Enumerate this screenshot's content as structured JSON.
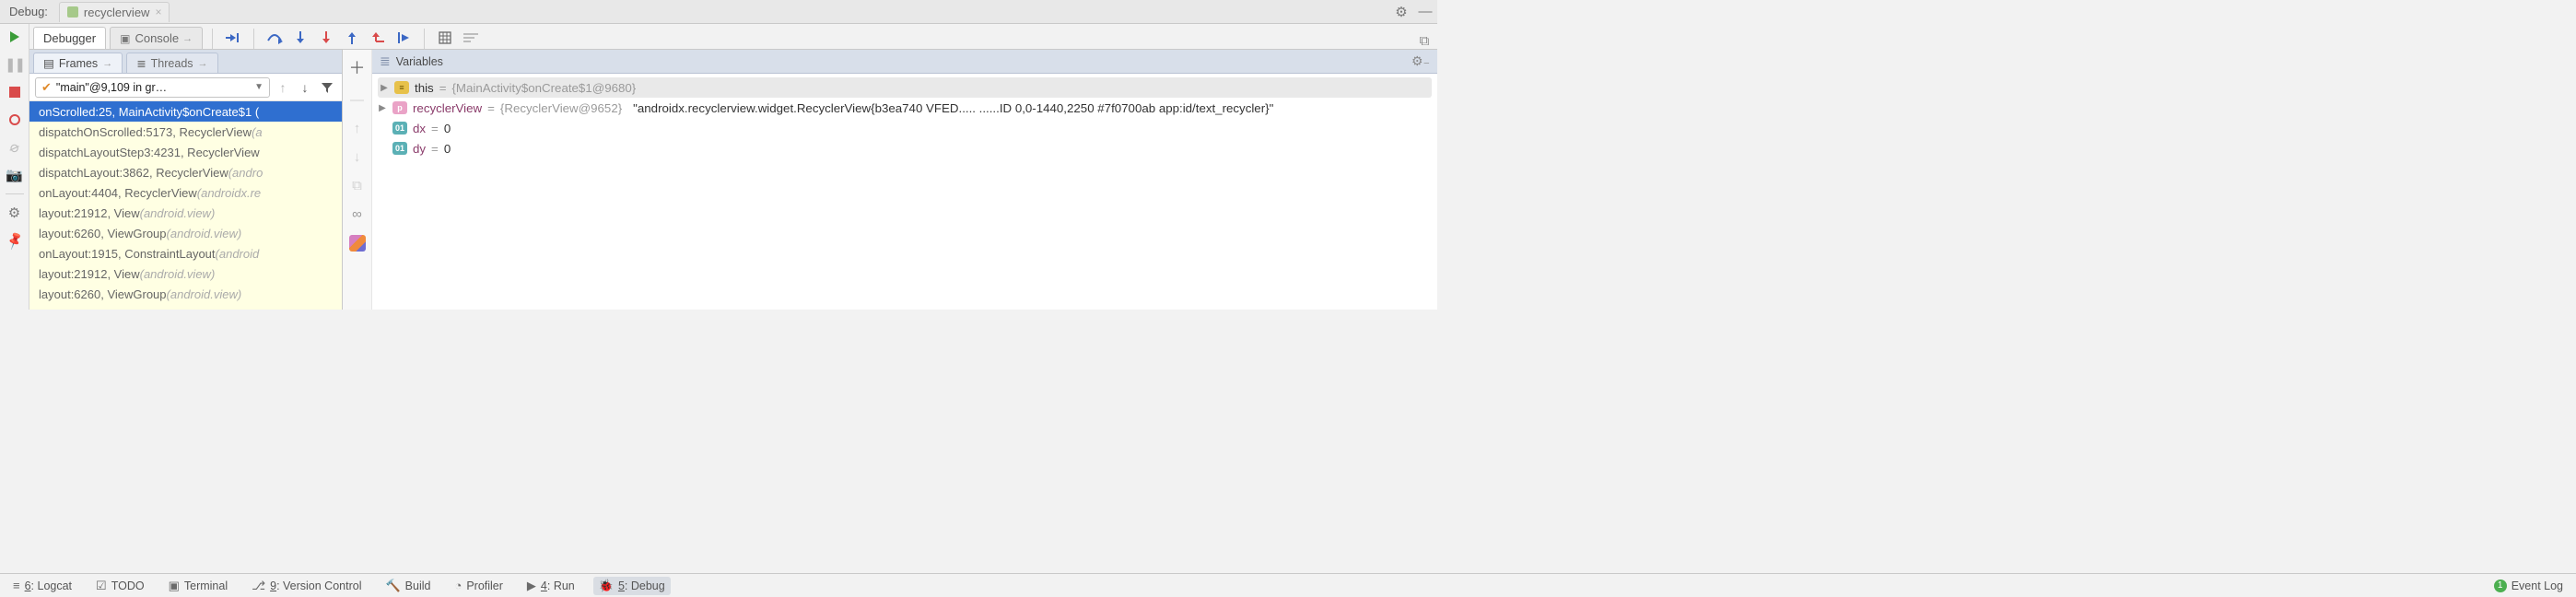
{
  "toolwindow": {
    "title": "Debug:"
  },
  "runconfig": {
    "name": "recyclerview"
  },
  "tabs": {
    "debugger": "Debugger",
    "console": "Console"
  },
  "panels": {
    "frames": "Frames",
    "threads": "Threads",
    "variables": "Variables"
  },
  "thread_selector": {
    "value": "\"main\"@9,109 in gr…"
  },
  "frames": [
    {
      "text": "onScrolled:25, MainActivity$onCreate$1 (",
      "selected": true
    },
    {
      "text": "dispatchOnScrolled:5173, RecyclerView ",
      "dim": "(a"
    },
    {
      "text": "dispatchLayoutStep3:4231, RecyclerView"
    },
    {
      "text": "dispatchLayout:3862, RecyclerView ",
      "dim": "(andro"
    },
    {
      "text": "onLayout:4404, RecyclerView ",
      "dim": "(androidx.re"
    },
    {
      "text": "layout:21912, View ",
      "dim": "(android.view)"
    },
    {
      "text": "layout:6260, ViewGroup ",
      "dim": "(android.view)"
    },
    {
      "text": "onLayout:1915, ConstraintLayout ",
      "dim": "(android"
    },
    {
      "text": "layout:21912, View ",
      "dim": "(android.view)"
    },
    {
      "text": "layout:6260, ViewGroup ",
      "dim": "(android.view)"
    }
  ],
  "variables": {
    "this_label": "this",
    "this_value": "{MainActivity$onCreate$1@9680}",
    "rv_name": "recyclerView",
    "rv_obj": "{RecyclerView@9652}",
    "rv_str": "\"androidx.recyclerview.widget.RecyclerView{b3ea740 VFED..... ......ID 0,0-1440,2250 #7f0700ab app:id/text_recycler}\"",
    "dx": {
      "name": "dx",
      "value": "0"
    },
    "dy": {
      "name": "dy",
      "value": "0"
    },
    "eq": " = "
  },
  "footer": {
    "logcat": {
      "key": "6",
      "label": ": Logcat"
    },
    "todo": "TODO",
    "terminal": "Terminal",
    "vcs": {
      "key": "9",
      "label": ": Version Control"
    },
    "build": "Build",
    "profiler": "Profiler",
    "run": {
      "key": "4",
      "label": ": Run"
    },
    "debug": {
      "key": "5",
      "label": ": Debug"
    },
    "eventlog": {
      "count": "1",
      "label": "Event Log"
    }
  }
}
